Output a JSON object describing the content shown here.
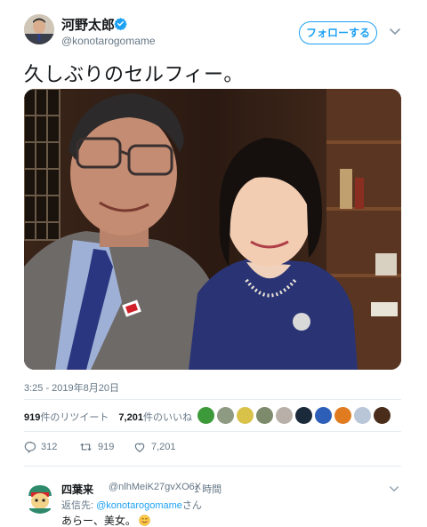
{
  "author": {
    "name": "河野太郎",
    "handle": "@konotarogomame",
    "verified": true
  },
  "follow_label": "フォローする",
  "tweet": {
    "text": "久しぶりのセルフィー。",
    "timestamp": "3:25 - 2019年8月20日"
  },
  "stats": {
    "retweets": {
      "count": "919",
      "label": "件のリツイート"
    },
    "likes": {
      "count": "7,201",
      "label": "件のいいね"
    }
  },
  "actions": {
    "reply_count": "312",
    "retweet_count": "919",
    "like_count": "7,201"
  },
  "liker_avatars": [
    {
      "icon": "avatar-green",
      "color": "#3d9a3a"
    },
    {
      "icon": "avatar-landscape",
      "color": "#8f9a82"
    },
    {
      "icon": "avatar-yellow",
      "color": "#d8c24a"
    },
    {
      "icon": "avatar-photo",
      "color": "#7d8a6b"
    },
    {
      "icon": "avatar-cat",
      "color": "#b8b0a8"
    },
    {
      "icon": "avatar-dark",
      "color": "#1b2a3a"
    },
    {
      "icon": "avatar-blue",
      "color": "#2d5fb8"
    },
    {
      "icon": "avatar-orange",
      "color": "#e07b1f"
    },
    {
      "icon": "avatar-sky",
      "color": "#b9c6d8"
    },
    {
      "icon": "avatar-night",
      "color": "#4a2c1a"
    }
  ],
  "reply": {
    "name": "四葉来",
    "handle": "@nlhMeiK27gvXO6X",
    "separator": "·",
    "time": "1 時間",
    "reply_to_prefix": "返信先:",
    "reply_to_mention": "@konotarogomame",
    "reply_to_suffix": "さん",
    "text": "あらー、美女。"
  },
  "colors": {
    "accent": "#1da1f2",
    "text": "#14171a",
    "muted": "#657786",
    "divider": "#e6ecf0"
  }
}
